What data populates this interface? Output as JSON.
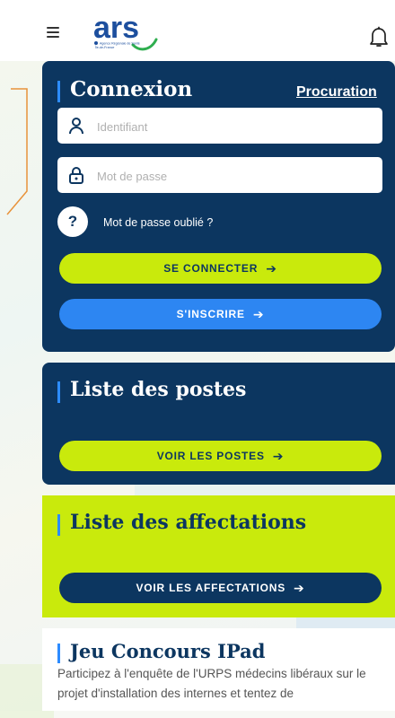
{
  "header": {
    "logo_main": "ars",
    "logo_sub_line1": "Agence Régionale de Santé",
    "logo_sub_line2": "Île-de-France"
  },
  "login": {
    "title": "Connexion",
    "procuration_link": "Procuration",
    "username_placeholder": "Identifiant",
    "password_placeholder": "Mot de passe",
    "help_symbol": "?",
    "forgot_password": "Mot de passe oublié ?",
    "connect_button": "SE CONNECTER",
    "register_button": "S'INSCRIRE"
  },
  "postes": {
    "title": "Liste des postes",
    "button": "VOIR LES POSTES"
  },
  "affectations": {
    "title": "Liste des affectations",
    "button": "VOIR LES AFFECTATIONS"
  },
  "jeu": {
    "title": "Jeu Concours IPad",
    "text": "Participez à l'enquête de l'URPS médecins libéraux sur le projet d'installation des internes et tentez de"
  },
  "icons": {
    "arrow": "➔"
  },
  "colors": {
    "navy": "#0c3660",
    "lime": "#c9ea0c",
    "blue": "#2d86f2",
    "accent_bar": "#2d8cff",
    "bracket": "#e8923a"
  }
}
